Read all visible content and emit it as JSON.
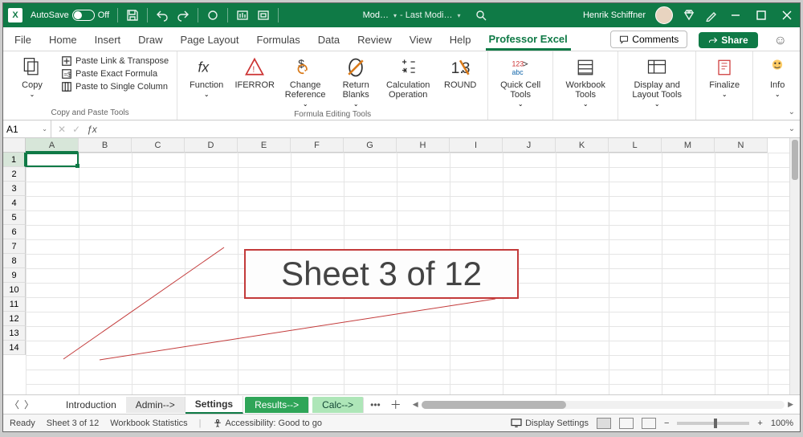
{
  "title": {
    "autosave_label": "AutoSave",
    "autosave_state": "Off",
    "doc_short": "Mod…",
    "last_mod_label": "- Last Modi…",
    "user_name": "Henrik Schiffner"
  },
  "tabs": {
    "file": "File",
    "home": "Home",
    "insert": "Insert",
    "draw": "Draw",
    "page_layout": "Page Layout",
    "formulas": "Formulas",
    "data": "Data",
    "review": "Review",
    "view": "View",
    "help": "Help",
    "professor_excel": "Professor Excel",
    "comments_btn": "Comments",
    "share": "Share"
  },
  "ribbon": {
    "group1": "Copy and Paste Tools",
    "copy": "Copy",
    "paste_link": "Paste Link & Transpose",
    "paste_exact": "Paste Exact Formula",
    "paste_single": "Paste to Single Column",
    "group2": "Formula Editing Tools",
    "function": "Function",
    "iferror": "IFERROR",
    "change_ref": "Change Reference",
    "return_blanks": "Return Blanks",
    "calc_op": "Calculation Operation",
    "round": "ROUND",
    "quick_cell": "Quick Cell Tools",
    "workbook": "Workbook Tools",
    "display_layout": "Display and Layout Tools",
    "finalize": "Finalize",
    "info": "Info"
  },
  "namebox": "A1",
  "cols": [
    "A",
    "B",
    "C",
    "D",
    "E",
    "F",
    "G",
    "H",
    "I",
    "J",
    "K",
    "L",
    "M",
    "N"
  ],
  "rows": [
    "1",
    "2",
    "3",
    "4",
    "5",
    "6",
    "7",
    "8",
    "9",
    "10",
    "11",
    "12",
    "13",
    "14"
  ],
  "callout": "Sheet 3 of 12",
  "sheets": {
    "introduction": "Introduction",
    "admin": "Admin-->",
    "settings": "Settings",
    "results": "Results-->",
    "calc": "Calc-->"
  },
  "status": {
    "ready": "Ready",
    "sheet": "Sheet 3 of 12",
    "wb": "Workbook Statistics",
    "accessibility": "Accessibility: Good to go",
    "display": "Display Settings",
    "zoom": "100%"
  }
}
